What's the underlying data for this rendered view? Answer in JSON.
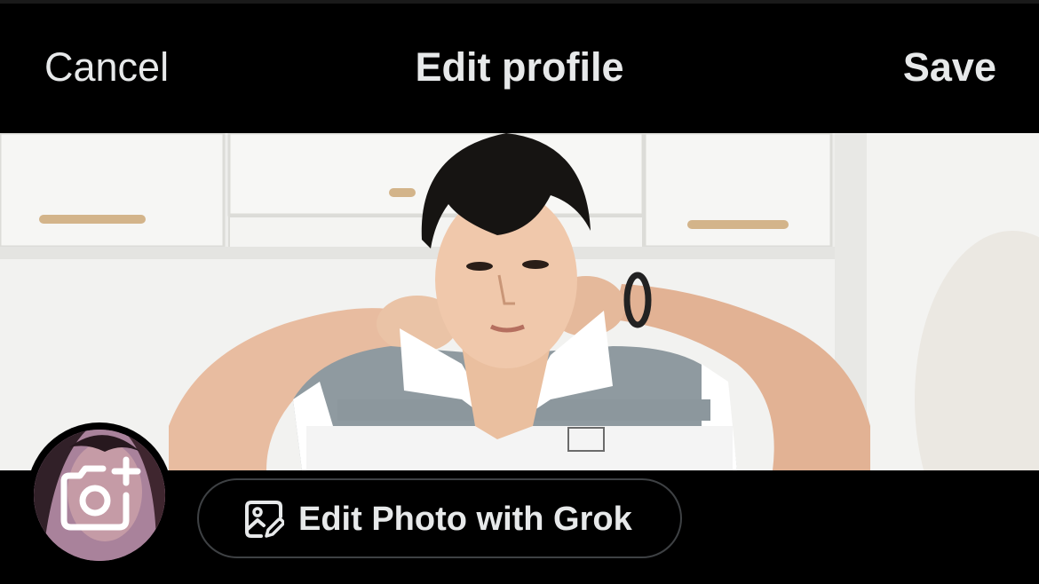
{
  "header": {
    "cancel_label": "Cancel",
    "title": "Edit profile",
    "save_label": "Save"
  },
  "banner": {
    "image_description": "header-photo"
  },
  "avatar": {
    "icon": "camera-plus-icon"
  },
  "grok_button": {
    "label": "Edit Photo with Grok",
    "icon": "image-edit-icon"
  },
  "colors": {
    "background": "#000000",
    "text": "#e7e9ea",
    "button_border": "#3e4144"
  }
}
